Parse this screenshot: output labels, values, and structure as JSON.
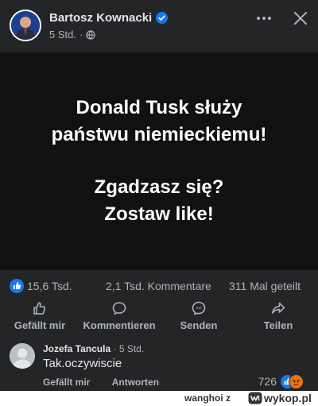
{
  "post": {
    "author": "Bartosz Kownacki",
    "time": "5 Std.",
    "image_text": {
      "line1": "Donald Tusk służy",
      "line2": "państwu niemieckiemu!",
      "line3": "Zgadzasz się?",
      "line4": "Zostaw like!"
    }
  },
  "stats": {
    "likes": "15,6 Tsd.",
    "comments": "2,1 Tsd. Kommentare",
    "shares": "311 Mal geteilt"
  },
  "actions": {
    "like": "Gefällt mir",
    "comment": "Kommentieren",
    "send": "Senden",
    "share": "Teilen"
  },
  "comment": {
    "author": "Jozefa Tancula",
    "time": "· 5 Std.",
    "text": "Tak.oczywiscie",
    "like_label": "Gefällt mir",
    "reply_label": "Antworten",
    "reaction_count": "726"
  },
  "watermark": {
    "user": "wanghoi",
    "suffix": "z",
    "logo_text": "wykop.pl"
  },
  "colors": {
    "background": "#242526",
    "image_background": "#111111",
    "accent_blue": "#1877f2",
    "angry_orange": "#e9710f"
  }
}
